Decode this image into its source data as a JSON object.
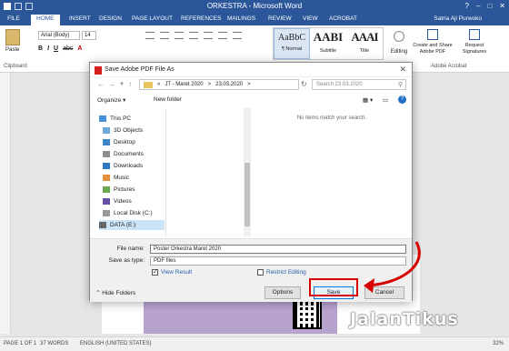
{
  "word": {
    "title": "ORKESTRA - Microsoft Word",
    "tabs": [
      "FILE",
      "HOME",
      "INSERT",
      "DESIGN",
      "PAGE LAYOUT",
      "REFERENCES",
      "MAILINGS",
      "REVIEW",
      "VIEW",
      "ACROBAT"
    ],
    "user": "Satria Aji Purwoko",
    "ribbon": {
      "paste": "Paste",
      "clipboard": "Clipboard",
      "font_name": "Arial (Body)",
      "font_size": "14",
      "styles": [
        {
          "preview": "AaBbC",
          "name": "¶ Normal"
        },
        {
          "preview": "AABI",
          "name": "Subtitle"
        },
        {
          "preview": "AAAI",
          "name": "Title"
        }
      ],
      "editing": "Editing",
      "acrobat_buttons": [
        "Create and Share Adobe PDF",
        "Request Signatures"
      ],
      "acrobat_group": "Adobe Acrobat"
    },
    "status": {
      "page": "PAGE 1 OF 1",
      "words": "37 WORDS",
      "language": "ENGLISH (UNITED STATES)",
      "zoom": "32%"
    }
  },
  "dialog": {
    "title": "Save Adobe PDF File As",
    "breadcrumb": [
      "«",
      "JT - Maret 2020",
      ">",
      "23.03.2020",
      ">"
    ],
    "search_placeholder": "Search 23.03.2020",
    "organize": "Organize ▾",
    "new_folder": "New folder",
    "empty_message": "No items match your search.",
    "nav_items": [
      {
        "label": "This PC",
        "color": "#4a90d9"
      },
      {
        "label": "3D Objects",
        "color": "#6fa8dc"
      },
      {
        "label": "Desktop",
        "color": "#3d85c6"
      },
      {
        "label": "Documents",
        "color": "#8e8e8e"
      },
      {
        "label": "Downloads",
        "color": "#2f78c4"
      },
      {
        "label": "Music",
        "color": "#e69138"
      },
      {
        "label": "Pictures",
        "color": "#6aa84f"
      },
      {
        "label": "Videos",
        "color": "#674ea7"
      },
      {
        "label": "Local Disk (C:)",
        "color": "#999999"
      },
      {
        "label": "DATA (E:)",
        "color": "#666666"
      }
    ],
    "file_name_label": "File name:",
    "file_name": "Poster Orkestra Maret 2020",
    "save_type_label": "Save as type:",
    "save_type": "PDF files",
    "view_result": "View Result",
    "restrict_editing": "Restrict Editing",
    "hide_folders": "Hide Folders",
    "options": "Options",
    "save": "Save",
    "cancel": "Cancel"
  },
  "watermark": "JalanTikus",
  "colors": {
    "word_blue": "#2b579a",
    "highlight_red": "#d60000"
  }
}
